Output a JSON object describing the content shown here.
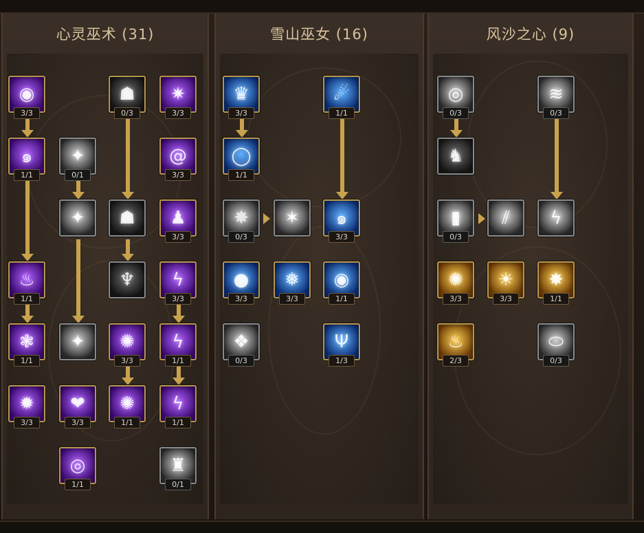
{
  "trees": [
    {
      "title": "心灵巫术 (31)"
    },
    {
      "title": "雪山巫女 (16)"
    },
    {
      "title": "风沙之心 (9)"
    }
  ],
  "colors": {
    "gold_border": "#b8974f",
    "arrow": "#c9a24e",
    "purple": "#7a2bd6",
    "blue": "#1f6fd6",
    "gray": "#6a6a6a",
    "orange": "#d88a1c"
  },
  "nodes": {
    "t1": [
      {
        "rank": "3/3",
        "icon": "purple-orb-icon"
      },
      {
        "rank": "0/3",
        "icon": "shadow-beast-icon"
      },
      {
        "rank": "3/3",
        "icon": "purple-starburst-icon"
      },
      {
        "rank": "1/1",
        "icon": "purple-vortex-icon"
      },
      {
        "rank": "0/1",
        "icon": "white-slash-icon"
      },
      {
        "rank": "3/3",
        "icon": "purple-spiral-icon"
      },
      {
        "rank": "",
        "icon": "white-slash-icon"
      },
      {
        "rank": "",
        "icon": "shadow-beast-icon"
      },
      {
        "rank": "3/3",
        "icon": "hooded-figure-icon"
      },
      {
        "rank": "1/1",
        "icon": "purple-flame-icon"
      },
      {
        "rank": "",
        "icon": "horned-demon-icon"
      },
      {
        "rank": "3/3",
        "icon": "purple-lightning-icon"
      },
      {
        "rank": "1/1",
        "icon": "purple-brain-icon"
      },
      {
        "rank": "",
        "icon": "white-slash-icon"
      },
      {
        "rank": "3/3",
        "icon": "purple-energy-icon"
      },
      {
        "rank": "1/1",
        "icon": "purple-lightning-icon"
      },
      {
        "rank": "3/3",
        "icon": "purple-burst-icon"
      },
      {
        "rank": "3/3",
        "icon": "purple-heart-icon"
      },
      {
        "rank": "1/1",
        "icon": "purple-energy-icon"
      },
      {
        "rank": "1/1",
        "icon": "purple-lightning-icon"
      },
      {
        "rank": "1/1",
        "icon": "purple-eye-icon"
      },
      {
        "rank": "0/1",
        "icon": "silver-mask-icon"
      }
    ],
    "t2": [
      {
        "rank": "3/3",
        "icon": "ice-crown-icon"
      },
      {
        "rank": "1/1",
        "icon": "blue-comet-icon"
      },
      {
        "rank": "1/1",
        "icon": "blue-ring-icon"
      },
      {
        "rank": "0/3",
        "icon": "white-burst-icon"
      },
      {
        "rank": "",
        "icon": "white-shatter-icon"
      },
      {
        "rank": "3/3",
        "icon": "blue-swirl-icon"
      },
      {
        "rank": "3/3",
        "icon": "ice-sphere-icon"
      },
      {
        "rank": "3/3",
        "icon": "ice-splash-icon"
      },
      {
        "rank": "1/1",
        "icon": "blue-eye-icon"
      },
      {
        "rank": "0/3",
        "icon": "ice-crystal-icon"
      },
      {
        "rank": "1/3",
        "icon": "trident-icon"
      }
    ],
    "t3": [
      {
        "rank": "0/3",
        "icon": "stone-spiral-icon"
      },
      {
        "rank": "0/3",
        "icon": "whirlwind-icon"
      },
      {
        "rank": "",
        "icon": "stone-golem-icon"
      },
      {
        "rank": "0/3",
        "icon": "rock-pillar-icon"
      },
      {
        "rank": "",
        "icon": "wind-slash-icon"
      },
      {
        "rank": "",
        "icon": "lightning-rock-icon"
      },
      {
        "rank": "3/3",
        "icon": "gold-vortex-icon"
      },
      {
        "rank": "3/3",
        "icon": "gold-sun-icon"
      },
      {
        "rank": "1/1",
        "icon": "gold-explosion-icon"
      },
      {
        "rank": "2/3",
        "icon": "fire-eruption-icon"
      },
      {
        "rank": "0/3",
        "icon": "dark-portal-icon"
      }
    ]
  }
}
